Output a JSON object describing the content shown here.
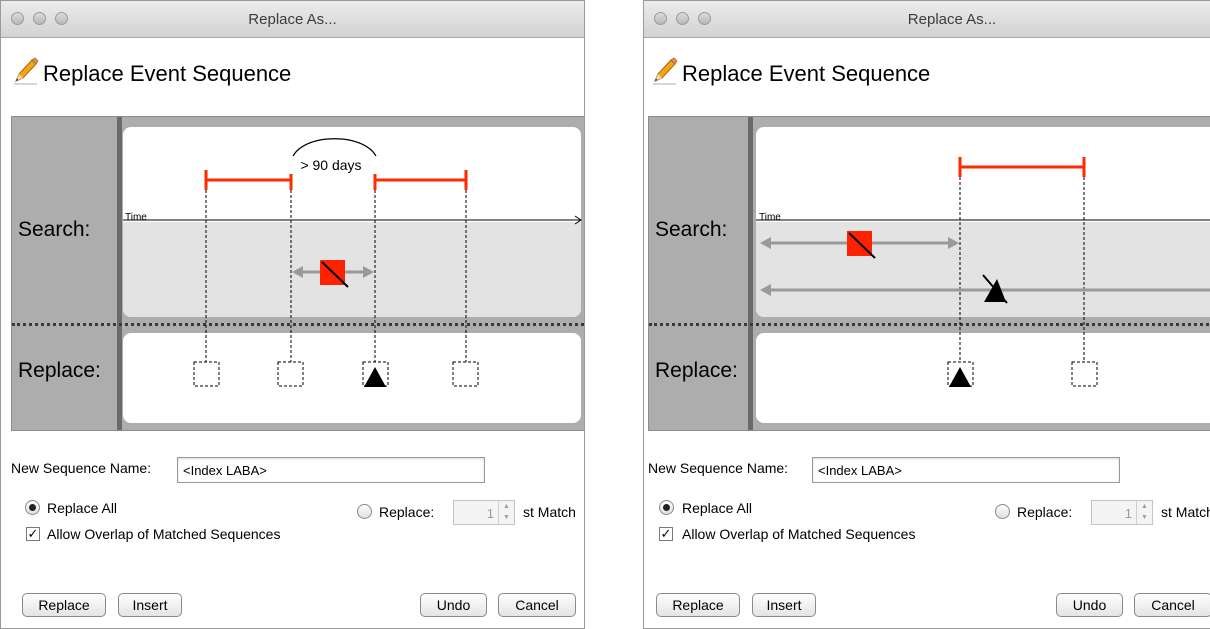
{
  "window_title": "Replace As...",
  "heading": "Replace Event Sequence",
  "search_label": "Search:",
  "replace_label": "Replace:",
  "time_label": "Time",
  "gap_label": "> 90 days",
  "name_label": "New Sequence Name:",
  "name_value": "<Index LABA>",
  "replace_all_label": "Replace All",
  "allow_overlap_label": "Allow Overlap of Matched Sequences",
  "allow_overlap_checked": true,
  "replace_nth_label": "Replace:",
  "nth_value": "1",
  "st_match_label": "st Match",
  "buttons": {
    "replace": "Replace",
    "insert": "Insert",
    "undo": "Undo",
    "cancel": "Cancel"
  },
  "colors": {
    "interval": "#ff2a00",
    "event_square": "#ff2200",
    "arrow_gray": "#9a9a9a",
    "panel_gray": "#adadad",
    "time_band": "#e3e3e3"
  },
  "icons": {
    "heading": "pencil-icon",
    "event_square": "red-square-slash-icon",
    "event_triangle": "black-triangle-icon"
  }
}
